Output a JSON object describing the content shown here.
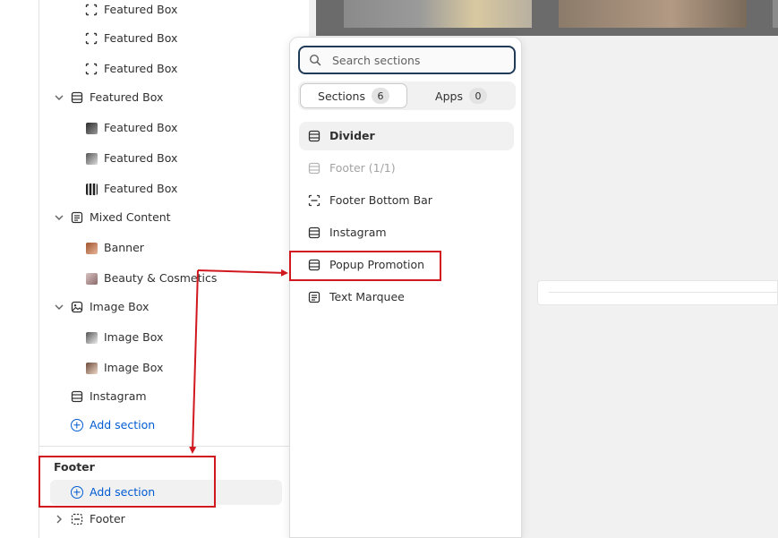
{
  "sidebar": {
    "rows": [
      {
        "label": "Featured Box",
        "icon": "dashed-square-icon"
      },
      {
        "label": "Featured Box",
        "icon": "dashed-square-icon"
      },
      {
        "label": "Featured Box",
        "icon": "dashed-square-icon"
      },
      {
        "label": "Featured Box",
        "icon": "section-icon",
        "expanded": true
      },
      {
        "label": "Featured Box",
        "icon": "logo-thumb"
      },
      {
        "label": "Featured Box",
        "icon": "logo-thumb"
      },
      {
        "label": "Featured Box",
        "icon": "logo-thumb"
      },
      {
        "label": "Mixed Content",
        "icon": "document-icon",
        "expanded": true
      },
      {
        "label": "Banner",
        "icon": "image-thumb"
      },
      {
        "label": "Beauty & Cosmetics",
        "icon": "image-thumb"
      },
      {
        "label": "Image Box",
        "icon": "image-icon",
        "expanded": true
      },
      {
        "label": "Image Box",
        "icon": "image-thumb"
      },
      {
        "label": "Image Box",
        "icon": "image-thumb"
      },
      {
        "label": "Instagram",
        "icon": "section-icon"
      }
    ],
    "add_section_label": "Add section",
    "footer_group": {
      "heading": "Footer",
      "add_section_label": "Add section",
      "footer_item_label": "Footer"
    }
  },
  "popover": {
    "search": {
      "placeholder": "Search sections",
      "value": ""
    },
    "tabs": [
      {
        "label": "Sections",
        "count": "6",
        "active": true
      },
      {
        "label": "Apps",
        "count": "0",
        "active": false
      }
    ],
    "sections": [
      {
        "label": "Divider",
        "icon": "section-icon",
        "state": "active"
      },
      {
        "label": "Footer (1/1)",
        "icon": "section-icon",
        "state": "disabled"
      },
      {
        "label": "Footer Bottom Bar",
        "icon": "dashed-section-icon",
        "state": "normal"
      },
      {
        "label": "Instagram",
        "icon": "section-icon",
        "state": "normal"
      },
      {
        "label": "Popup Promotion",
        "icon": "section-icon",
        "state": "normal"
      },
      {
        "label": "Text Marquee",
        "icon": "document-icon",
        "state": "normal"
      }
    ]
  },
  "colors": {
    "accent_link": "#005bd3",
    "annotation_red": "#d0181e",
    "search_border": "#1f3b57",
    "text_primary": "#303030",
    "text_disabled": "#a3a3a3"
  }
}
